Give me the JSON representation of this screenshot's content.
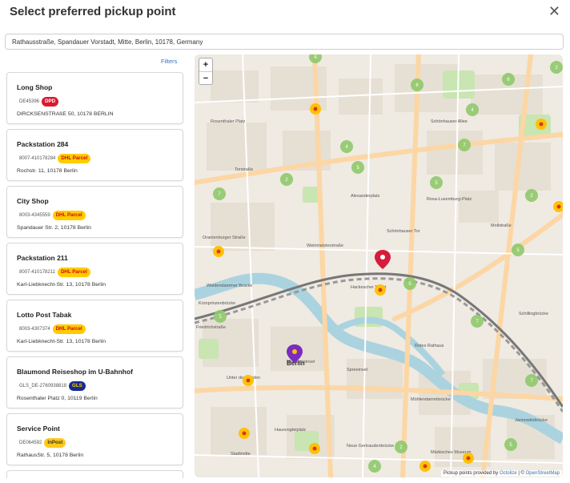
{
  "header": {
    "title": "Select preferred pickup point",
    "close_icon": "close-icon"
  },
  "search": {
    "value": "Rathausstraße, Spandauer Vorstadt, Mitte, Berlin, 10178, Germany"
  },
  "filters": {
    "label": "Filters"
  },
  "locations": [
    {
      "name": "Long Shop",
      "code": "DE45396",
      "carrier": "DPD",
      "carrier_color": "#d81a2f",
      "address": "DIRCKSENSTRAßE 50, 10178 BERLIN"
    },
    {
      "name": "Packstation 284",
      "code": "8007-410178284",
      "carrier": "DHL Parcel",
      "carrier_color": "#ffcc00",
      "address": "Rochstr. 11, 10178 Berlin"
    },
    {
      "name": "City Shop",
      "code": "8003-4345559",
      "carrier": "DHL Parcel",
      "carrier_color": "#ffcc00",
      "address": "Spandauer Str. 2, 10178 Berlin"
    },
    {
      "name": "Packstation 211",
      "code": "8007-410178211",
      "carrier": "DHL Parcel",
      "carrier_color": "#ffcc00",
      "address": "Karl-Liebknecht-Str. 13, 10178 Berlin"
    },
    {
      "name": "Lotto Post Tabak",
      "code": "8003-4307374",
      "carrier": "DHL Parcel",
      "carrier_color": "#ffcc00",
      "address": "Karl-Liebknecht-Str. 13, 10178 Berlin"
    },
    {
      "name": "Blaumond Reiseshop im U-Bahnhof",
      "code": "GLS_DE-2760938818",
      "carrier": "GLS",
      "carrier_color": "#172b8f",
      "address": "Rosenthaler Platz 0, 10119 Berlin"
    },
    {
      "name": "Service Point",
      "code": "DE064592",
      "carrier": "InPost",
      "carrier_color": "#ffc91c",
      "address": "RathausStr. 5, 10178 Berlin"
    }
  ],
  "map": {
    "zoom_in": "+",
    "zoom_out": "−",
    "attribution_prefix": "Pickup points provided by",
    "attribution_link1": "Octolize",
    "attribution_sep": "| ©",
    "attribution_link2": "OpenStreetMap",
    "labels": {
      "berlin": "Berlin",
      "rosa_luxemburg_platz": "Rosa-Luxemburg-Platz",
      "schoenhauser": "Schönhauser Tor",
      "oranienburger_strasse": "Oranienburger Straße",
      "hackescher_markt": "Hackescher Markt",
      "friedrichstrasse": "Friedrichstraße",
      "spreeinsel": "Spreeinsel",
      "unter_den_linden": "Unter den Linden",
      "rotes_rathaus": "Rotes Rathaus",
      "muehlendammbruecke": "Mühlendammbrücke",
      "schillingbruecke": "Schillingbrücke",
      "alexanderplatz": "Alexanderplatz",
      "torstrasse": "Torstraße",
      "museumsinsel": "Museumsinsel",
      "jannowitzbruecke": "Jannowitzbrücke",
      "hausvogteiplatz": "Hausvogteiplatz",
      "stadtmitte": "Stadtmitte",
      "neue_gertraudenbruecke": "Neue Gertraudenbrücke",
      "schoenhauser_allee": "Schönhauser Allee",
      "maerkisches_museum": "Märkisches Museum",
      "weidendammer_bruecke": "Weidendammer Brücke",
      "kronprinzenbruecke": "Kronprinzenbrücke",
      "rosenthaler_platz": "Rosenthaler Platz",
      "weinmeisterstrasse": "Weinmeisterstraße",
      "mollstrasse": "Mollstraße"
    },
    "clusters": [
      "8",
      "6",
      "4",
      "6",
      "4",
      "7",
      "5",
      "2",
      "5",
      "7",
      "2",
      "5",
      "5",
      "5",
      "7",
      "7",
      "5",
      "2",
      "4",
      "2",
      "6",
      "7"
    ]
  }
}
